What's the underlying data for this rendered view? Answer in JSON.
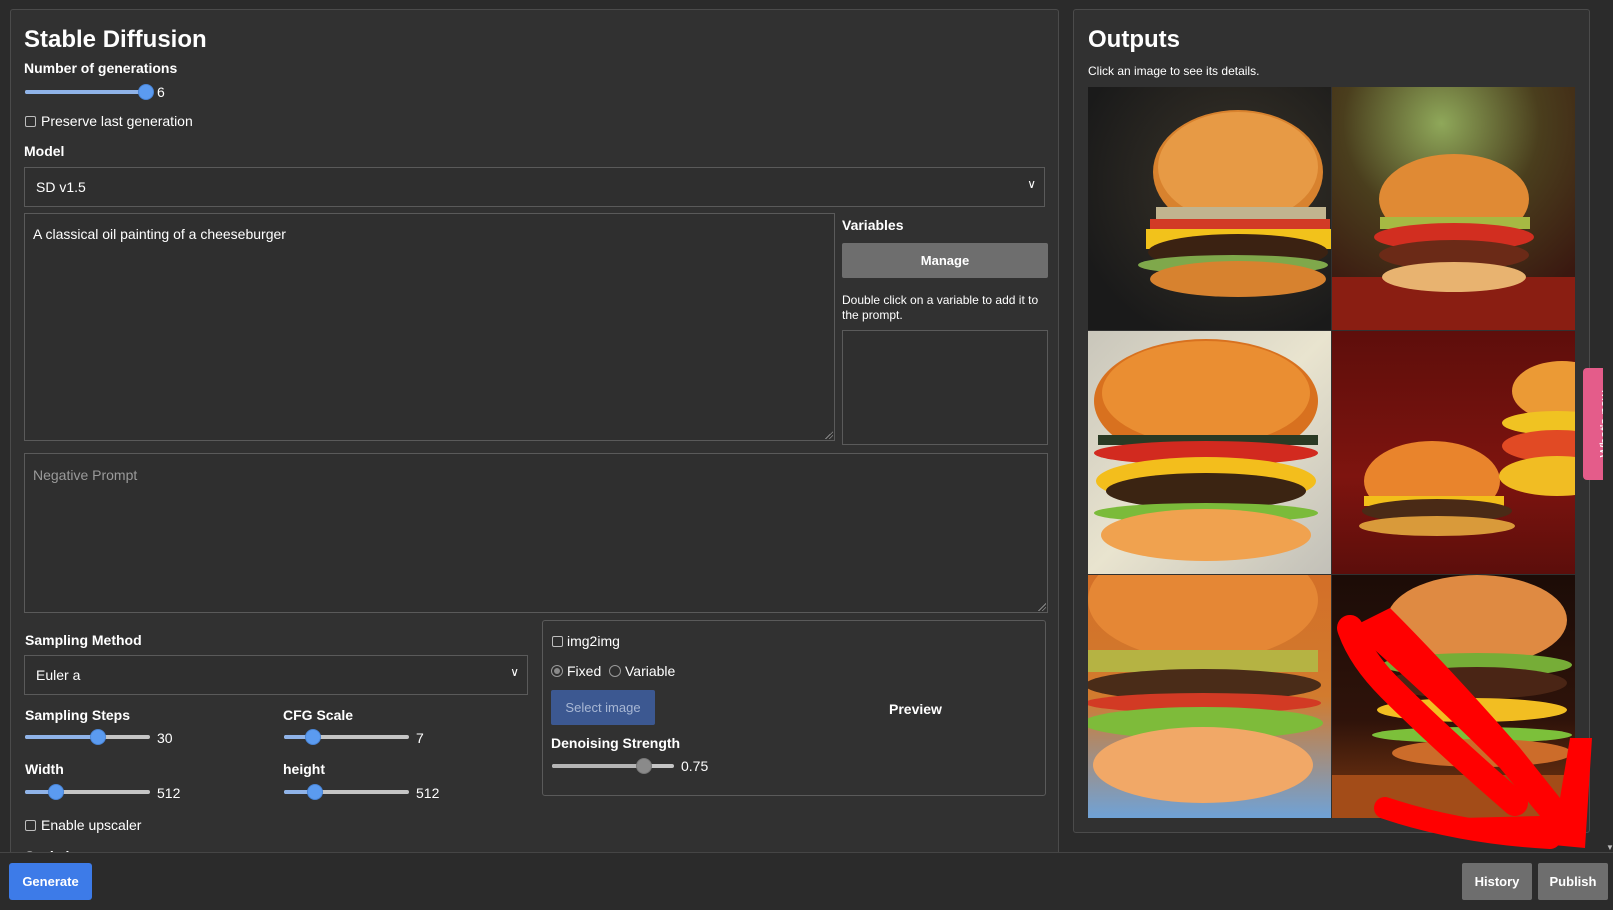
{
  "app": {
    "title": "Stable Diffusion",
    "generations_label": "Number of generations",
    "generations_value": "6",
    "generations_fraction": 1.0,
    "preserve_label": "Preserve last generation",
    "model_label": "Model",
    "model_value": "SD v1.5",
    "prompt": "A classical oil painting of a cheeseburger",
    "negative_prompt_placeholder": "Negative Prompt",
    "variables": {
      "title": "Variables",
      "manage_label": "Manage",
      "help_text": "Double click on a variable to add it to the prompt."
    },
    "sampling": {
      "method_label": "Sampling Method",
      "method_value": "Euler a",
      "steps_label": "Sampling Steps",
      "steps_value": "30",
      "steps_fraction": 0.58,
      "cfg_label": "CFG Scale",
      "cfg_value": "7",
      "cfg_fraction": 0.23,
      "width_label": "Width",
      "width_value": "512",
      "width_fraction": 0.25,
      "height_label": "height",
      "height_value": "512",
      "height_fraction": 0.25,
      "upscaler_label": "Enable upscaler",
      "scale_label": "Scale by"
    },
    "img2img": {
      "label": "img2img",
      "fixed_label": "Fixed",
      "variable_label": "Variable",
      "select_image_label": "Select image",
      "preview_label": "Preview",
      "denoising_label": "Denoising Strength",
      "denoising_value": "0.75",
      "denoising_fraction": 0.75
    }
  },
  "outputs": {
    "title": "Outputs",
    "subtitle": "Click an image to see its details."
  },
  "whats_new_label": "What's new",
  "footer": {
    "generate_label": "Generate",
    "history_label": "History",
    "publish_label": "Publish"
  },
  "colors": {
    "accent": "#3d7be8",
    "pink_tab": "#e45c8a",
    "annotation_arrow": "#ff0000"
  }
}
